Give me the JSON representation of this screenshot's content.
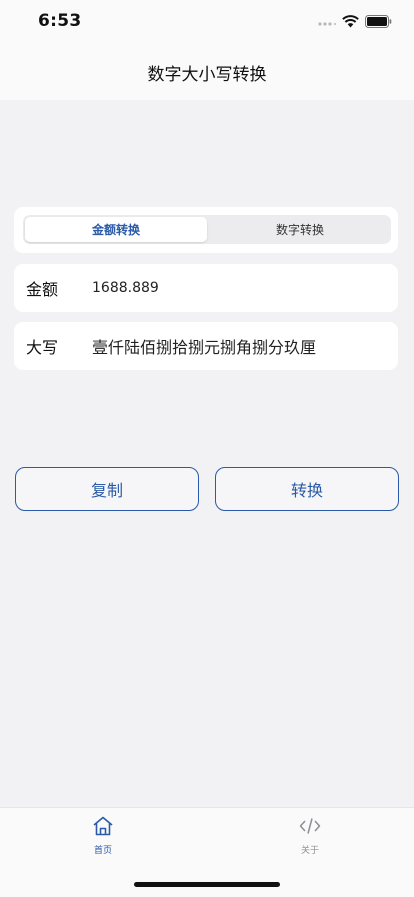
{
  "status_bar": {
    "time": "6:53"
  },
  "nav": {
    "title": "数字大小写转换"
  },
  "segments": {
    "active": "金额转换",
    "inactive": "数字转换"
  },
  "amount_row": {
    "label": "金额",
    "value": "1688.889"
  },
  "upper_row": {
    "label": "大写",
    "value": "壹仟陆佰捌拾捌元捌角捌分玖厘"
  },
  "buttons": {
    "copy": "复制",
    "convert": "转换"
  },
  "tabs": [
    {
      "label": "首页",
      "icon": "home-icon",
      "active": true
    },
    {
      "label": "关于",
      "icon": "code-icon",
      "active": false
    }
  ],
  "colors": {
    "accent": "#2a5aa8",
    "inactive": "#8e8e93",
    "background": "#f2f2f4"
  }
}
